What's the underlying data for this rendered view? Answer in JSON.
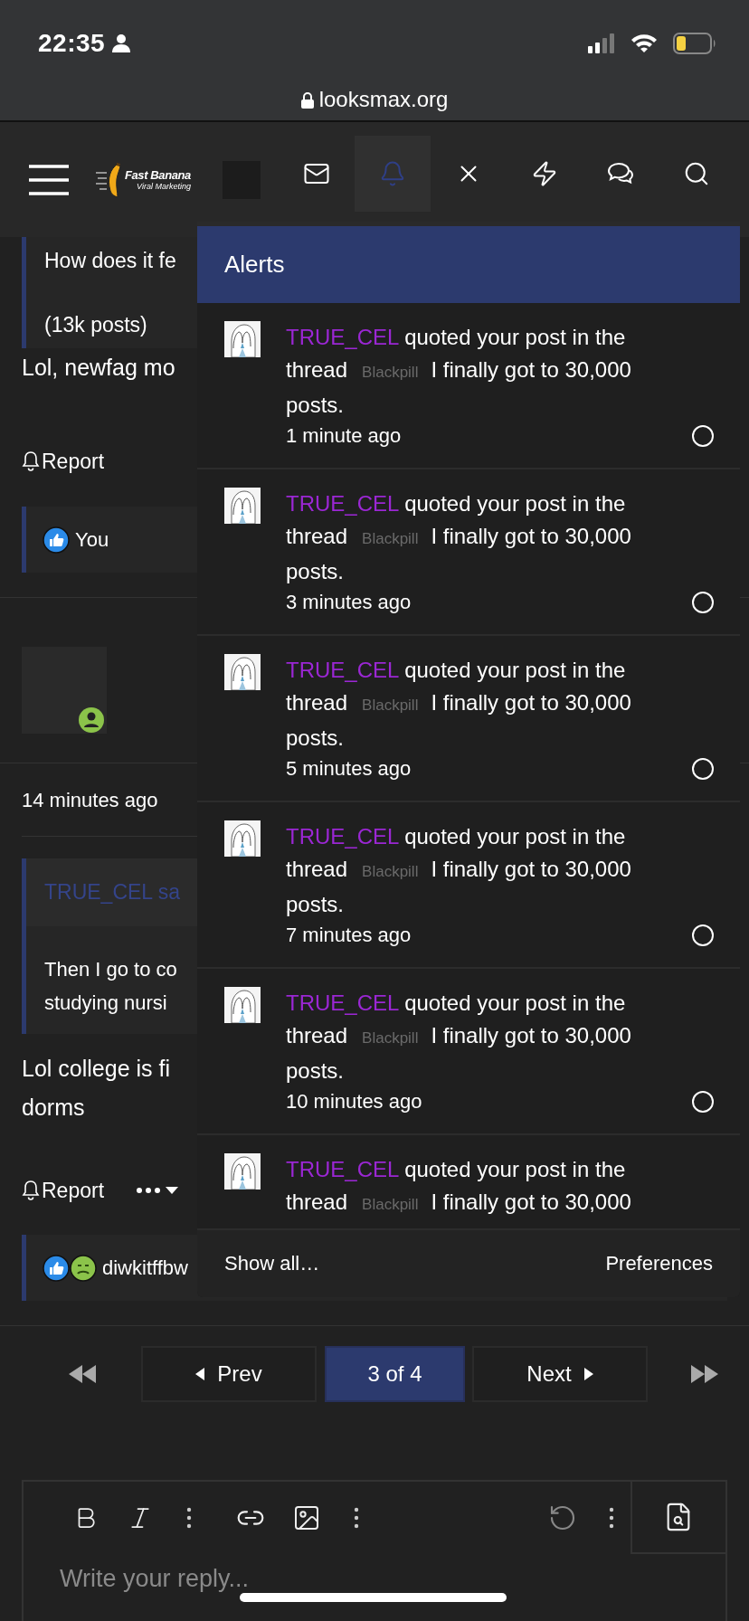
{
  "status_bar": {
    "time": "22:35"
  },
  "address_bar": {
    "url": "looksmax.org"
  },
  "nav": {
    "logo": {
      "title": "Fast Banana",
      "tagline": "Viral Marketing"
    },
    "icons": [
      {
        "kind": "mail",
        "selected": false
      },
      {
        "kind": "bell",
        "selected": true
      },
      {
        "kind": "close",
        "selected": false
      },
      {
        "kind": "bolt",
        "selected": false
      },
      {
        "kind": "chat",
        "selected": false
      },
      {
        "kind": "search",
        "selected": false
      }
    ]
  },
  "posts": [
    {
      "kind": "tail",
      "quote_lines": [
        "How does it fe",
        "(13k posts)"
      ],
      "message_lines": [
        "Lol, newfag mo"
      ],
      "report": "Report",
      "reactions": [
        {
          "kind": "like"
        }
      ],
      "reaction_text": "You"
    },
    {
      "kind": "full",
      "time": "14 minutes ago",
      "quote": {
        "author": "TRUE_CEL sa",
        "lines": [
          "Then I go to co",
          "studying nursi"
        ]
      },
      "message_lines": [
        "Lol college is fi",
        "dorms"
      ],
      "report": "Report",
      "reactions": [
        {
          "kind": "like"
        },
        {
          "kind": "sick"
        }
      ],
      "reaction_text": "diwkitffbw"
    }
  ],
  "pagination": {
    "prev": "Prev",
    "current": "3 of 4",
    "next": "Next"
  },
  "editor": {
    "placeholder": "Write your reply..."
  },
  "alerts": {
    "title": "Alerts",
    "items": [
      {
        "user": "TRUE_CEL",
        "action": "quoted your post in the thread",
        "prefix": "Blackpill",
        "title": "I finally got to 30,000 posts.",
        "time": "1 minute ago"
      },
      {
        "user": "TRUE_CEL",
        "action": "quoted your post in the thread",
        "prefix": "Blackpill",
        "title": "I finally got to 30,000 posts.",
        "time": "3 minutes ago"
      },
      {
        "user": "TRUE_CEL",
        "action": "quoted your post in the thread",
        "prefix": "Blackpill",
        "title": "I finally got to 30,000 posts.",
        "time": "5 minutes ago"
      },
      {
        "user": "TRUE_CEL",
        "action": "quoted your post in the thread",
        "prefix": "Blackpill",
        "title": "I finally got to 30,000 posts.",
        "time": "7 minutes ago"
      },
      {
        "user": "TRUE_CEL",
        "action": "quoted your post in the thread",
        "prefix": "Blackpill",
        "title": "I finally got to 30,000 posts.",
        "time": "10 minutes ago"
      },
      {
        "user": "TRUE_CEL",
        "action": "quoted your post in the thread",
        "prefix": "Blackpill",
        "title": "I finally got to 30,000"
      }
    ],
    "footer": {
      "show_all": "Show all…",
      "preferences": "Preferences"
    }
  }
}
